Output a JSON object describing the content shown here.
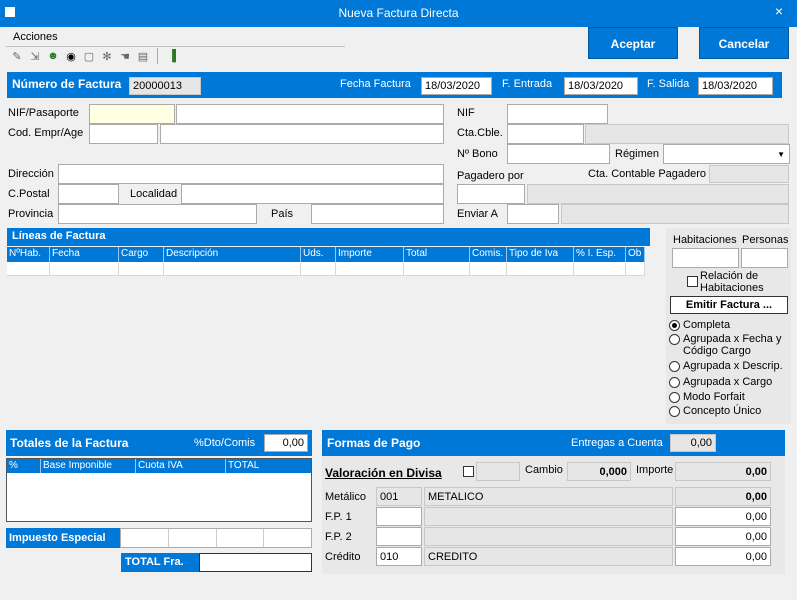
{
  "window": {
    "title": "Nueva Factura Directa",
    "close": "×"
  },
  "menu": {
    "acciones": "Acciones"
  },
  "buttons": {
    "aceptar": "Aceptar",
    "cancelar": "Cancelar",
    "emitir": "Emitir Factura ..."
  },
  "header": {
    "numero_label": "Número de Factura",
    "numero_value": "20000013",
    "fecha_label": "Fecha Factura",
    "fecha_value": "18/03/2020",
    "entrada_label": "F. Entrada",
    "entrada_value": "18/03/2020",
    "salida_label": "F. Salida",
    "salida_value": "18/03/2020"
  },
  "client": {
    "nif_pasaporte": "NIF/Pasaporte",
    "cod_empr": "Cod. Empr/Age",
    "direccion": "Dirección",
    "cpostal": "C.Postal",
    "localidad": "Localidad",
    "provincia": "Provincia",
    "pais": "País",
    "nif": "NIF",
    "cta_cble": "Cta.Cble.",
    "nbono": "Nº Bono",
    "regimen": "Régimen",
    "pagadero": "Pagadero por",
    "cta_contable_pagadero": "Cta. Contable Pagadero",
    "enviar_a": "Enviar A"
  },
  "lines": {
    "title": "Líneas de Factura",
    "columns": [
      "NºHab.",
      "Fecha",
      "Cargo",
      "Descripción",
      "Uds.",
      "Importe",
      "Total",
      "Comis.",
      "Tipo de Iva",
      "% I. Esp.",
      "Ob"
    ]
  },
  "side": {
    "habitaciones": "Habitaciones",
    "personas": "Personas",
    "relacion": "Relación de Habitaciones",
    "options": [
      "Completa",
      "Agrupada x Fecha y Código Cargo",
      "Agrupada x Descrip.",
      "Agrupada x Cargo",
      "Modo Forfait",
      "Concepto Único"
    ],
    "selected": "Completa"
  },
  "totales": {
    "title": "Totales de la Factura",
    "dto_label": "%Dto/Comis",
    "dto_value": "0,00",
    "columns": [
      "%",
      "Base Imponible",
      "Cuota IVA",
      "TOTAL"
    ],
    "impuesto": "Impuesto Especial",
    "total_fra": "TOTAL Fra."
  },
  "pago": {
    "title": "Formas de Pago",
    "entregas_label": "Entregas a Cuenta",
    "entregas_value": "0,00",
    "valoracion": "Valoración en Divisa",
    "cambio_label": "Cambio",
    "cambio_value": "0,000",
    "importe_label": "Importe",
    "importe_value": "0,00",
    "rows": [
      {
        "label": "Metálico",
        "code": "001",
        "desc": "METALICO",
        "value": "0,00"
      },
      {
        "label": "F.P. 1",
        "code": "",
        "desc": "",
        "value": "0,00"
      },
      {
        "label": "F.P. 2",
        "code": "",
        "desc": "",
        "value": "0,00"
      },
      {
        "label": "Crédito",
        "code": "010",
        "desc": "CREDITO",
        "value": "0,00"
      }
    ]
  },
  "colors": {
    "accent": "#0078d7",
    "panel": "#e8e8e8",
    "nif_highlight": "#ffffe1"
  },
  "icons": [
    "eraser-icon",
    "import-icon",
    "person-add-icon",
    "binoculars-icon",
    "page-icon",
    "settings-icon",
    "hand-icon",
    "document-icon",
    "exit-door-icon"
  ]
}
